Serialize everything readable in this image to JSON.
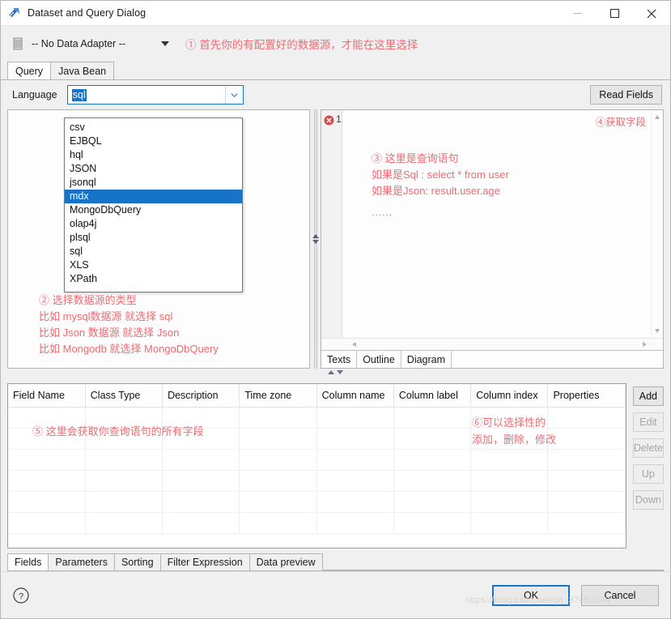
{
  "window": {
    "title": "Dataset and Query Dialog",
    "icon": "app-icon",
    "minimize": "minimize-icon",
    "maximize": "maximize-icon",
    "close": "close-icon"
  },
  "adapter": {
    "icon": "database-icon",
    "value": "-- No Data Adapter --",
    "caret": "chevron-down-icon"
  },
  "annotations": {
    "a1": "① 首先你的有配置好的数据源，才能在这里选择",
    "a2": [
      "② 选择数据源的类型",
      "比如 mysql数据源 就选择  sql",
      "比如 Json 数据源 就选择 Json",
      "比如 Mongodb 就选择 MongoDbQuery"
    ],
    "a3": [
      "③ 这里是查询语句",
      "如果是Sql : select * from user",
      "如果是Json: result.user.age"
    ],
    "a3_dots": "......",
    "a4": "④获取字段",
    "a5": "⑤ 这里会获取你查询语句的所有字段",
    "a6": [
      "⑥可以选择性的",
      "添加，删除，修改"
    ]
  },
  "top_tabs": [
    {
      "label": "Query",
      "active": true
    },
    {
      "label": "Java Bean",
      "active": false
    }
  ],
  "query": {
    "language_label": "Language",
    "language_value": "sql",
    "language_caret": "chevron-down-icon",
    "read_fields_label": "Read Fields",
    "language_options": [
      {
        "label": "csv",
        "selected": false
      },
      {
        "label": "EJBQL",
        "selected": false
      },
      {
        "label": "hql",
        "selected": false
      },
      {
        "label": "JSON",
        "selected": false
      },
      {
        "label": "jsonql",
        "selected": false
      },
      {
        "label": "mdx",
        "selected": true
      },
      {
        "label": "MongoDbQuery",
        "selected": false
      },
      {
        "label": "olap4j",
        "selected": false
      },
      {
        "label": "plsql",
        "selected": false
      },
      {
        "label": "sql",
        "selected": false
      },
      {
        "label": "XLS",
        "selected": false
      },
      {
        "label": "XPath",
        "selected": false
      }
    ]
  },
  "editor": {
    "error_icon": "error-marker-icon",
    "line_number": "1",
    "tabs": [
      {
        "label": "Texts",
        "active": true
      },
      {
        "label": "Outline",
        "active": false
      },
      {
        "label": "Diagram",
        "active": false
      }
    ]
  },
  "table": {
    "columns": [
      "Field Name",
      "Class Type",
      "Description",
      "Time zone",
      "Column name",
      "Column label",
      "Column index",
      "Properties"
    ],
    "rows": [],
    "empty_row_count": 6
  },
  "side_buttons": [
    {
      "label": "Add",
      "enabled": true
    },
    {
      "label": "Edit",
      "enabled": false
    },
    {
      "label": "Delete",
      "enabled": false
    },
    {
      "label": "Up",
      "enabled": false
    },
    {
      "label": "Down",
      "enabled": false
    }
  ],
  "bottom_tabs": [
    {
      "label": "Fields",
      "active": true
    },
    {
      "label": "Parameters",
      "active": false
    },
    {
      "label": "Sorting",
      "active": false
    },
    {
      "label": "Filter Expression",
      "active": false
    },
    {
      "label": "Data preview",
      "active": false
    }
  ],
  "footer": {
    "help_icon": "help-icon",
    "ok_label": "OK",
    "cancel_label": "Cancel",
    "watermark": "https://blog.csdn.net/qq_37450040"
  },
  "colors": {
    "accent": "#1673c8",
    "annotation": "#ef6b72",
    "window_bg": "#f0f0f0",
    "panel_bg": "#fdfdfd"
  }
}
